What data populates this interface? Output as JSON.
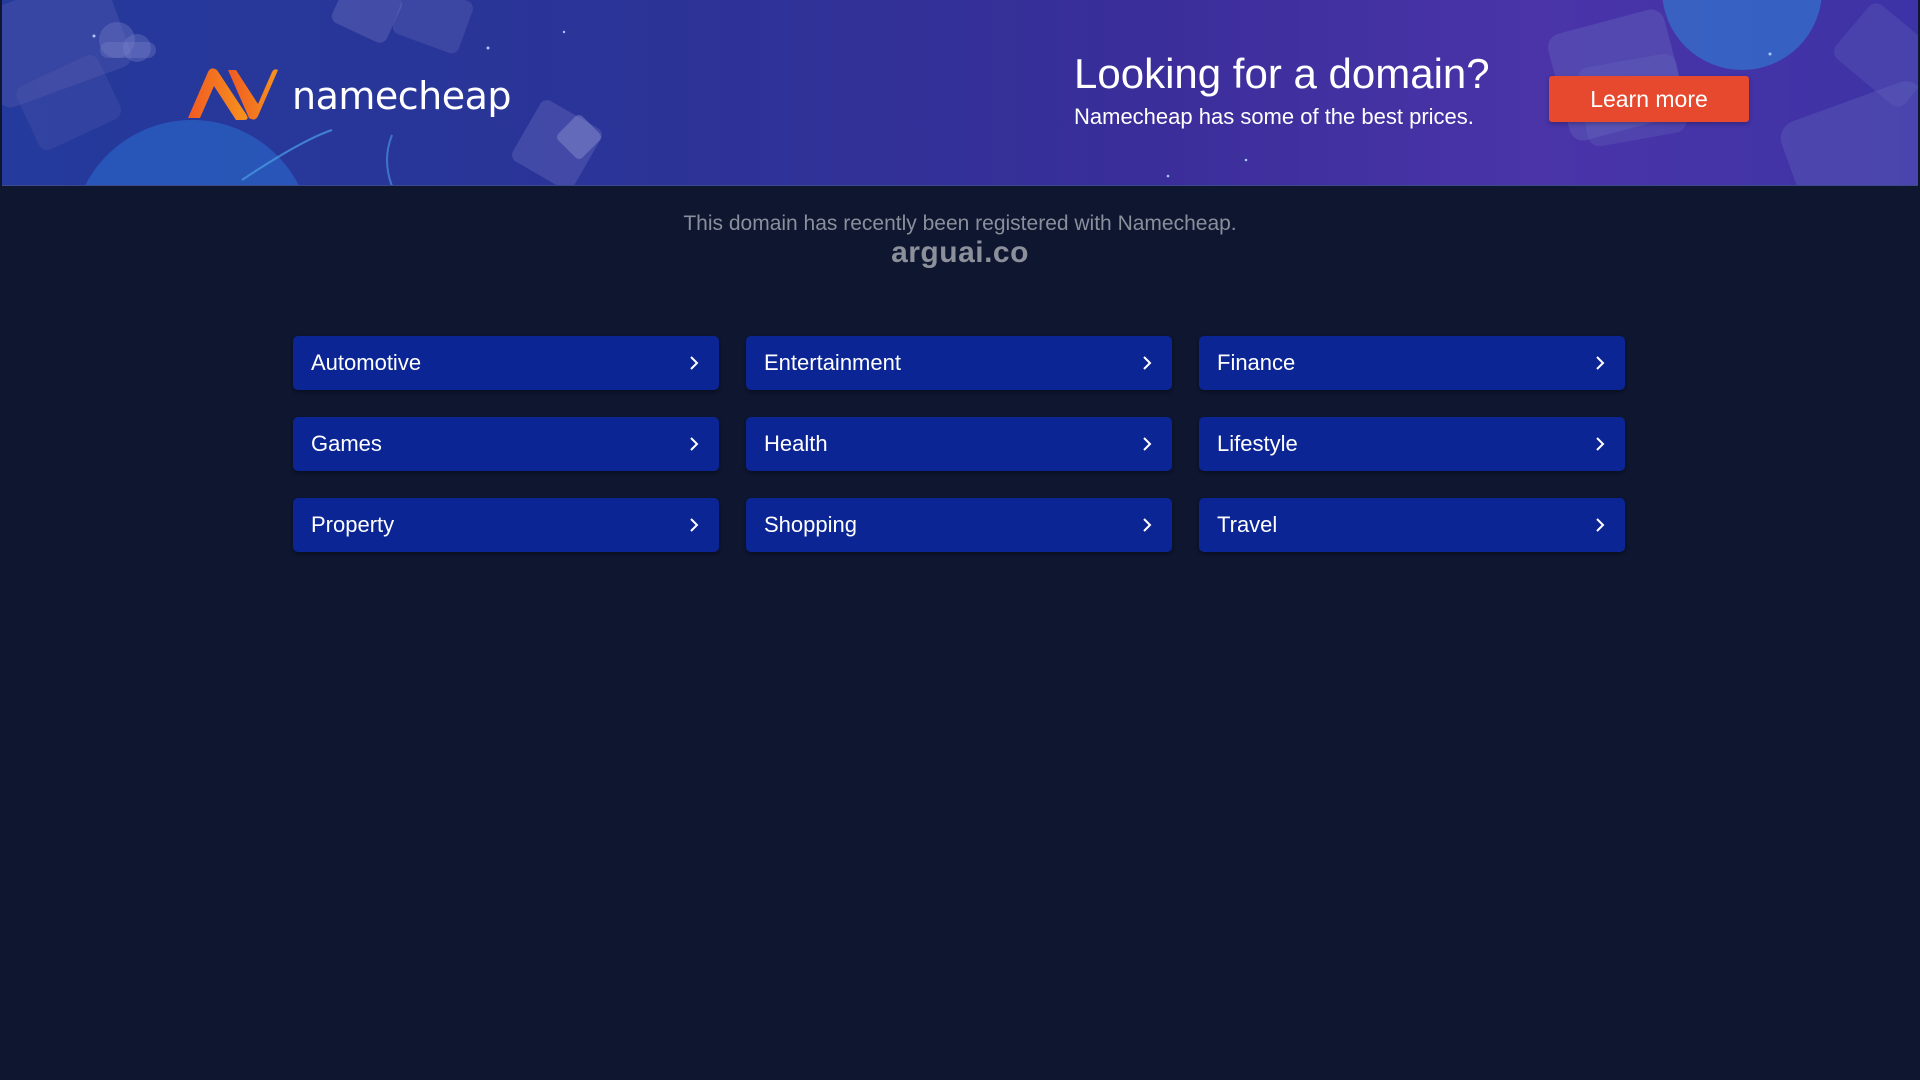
{
  "banner": {
    "brand": "namecheap",
    "headline": "Looking for a domain?",
    "subline": "Namecheap has some of the best prices.",
    "cta_label": "Learn more",
    "brand_color": "#f36b21",
    "cta_color": "#e7492f"
  },
  "main": {
    "notice": "This domain has recently been registered with Namecheap.",
    "domain": "arguai.co",
    "categories": [
      {
        "label": "Automotive",
        "icon": "chevron-right-icon"
      },
      {
        "label": "Entertainment",
        "icon": "chevron-right-icon"
      },
      {
        "label": "Finance",
        "icon": "chevron-right-icon"
      },
      {
        "label": "Games",
        "icon": "chevron-right-icon"
      },
      {
        "label": "Health",
        "icon": "chevron-right-icon"
      },
      {
        "label": "Lifestyle",
        "icon": "chevron-right-icon"
      },
      {
        "label": "Property",
        "icon": "chevron-right-icon"
      },
      {
        "label": "Shopping",
        "icon": "chevron-right-icon"
      },
      {
        "label": "Travel",
        "icon": "chevron-right-icon"
      }
    ]
  }
}
